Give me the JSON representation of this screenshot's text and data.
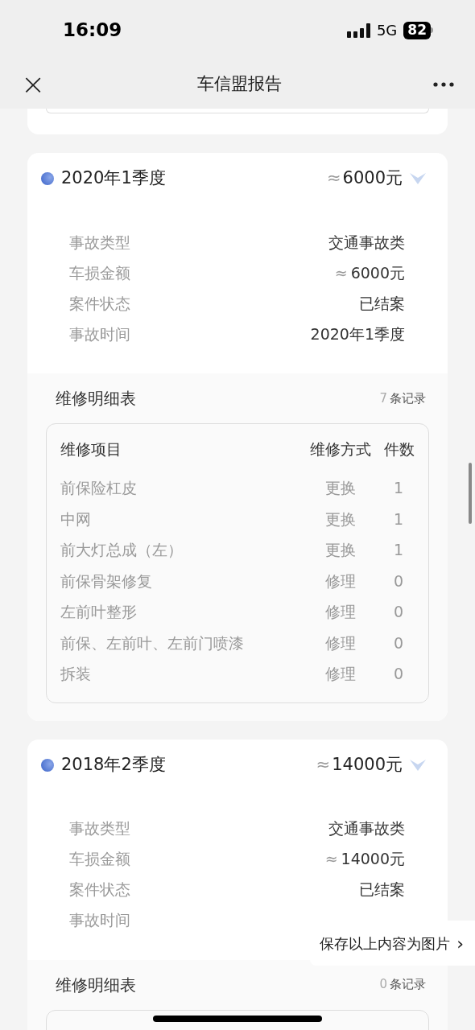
{
  "status_bar": {
    "time": "16:09",
    "network": "5G",
    "battery": "82"
  },
  "nav": {
    "close": "×",
    "title": "车信盟报告"
  },
  "records": [
    {
      "period": "2020年1季度",
      "approx": "≈",
      "amount": "6000元",
      "details": [
        {
          "label": "事故类型",
          "value": "交通事故类"
        },
        {
          "label": "车损金额",
          "approx": "≈",
          "value": "6000元"
        },
        {
          "label": "案件状态",
          "value": "已结案"
        },
        {
          "label": "事故时间",
          "value": "2020年1季度"
        }
      ],
      "repair": {
        "title": "维修明细表",
        "count": "7",
        "unit": "条记录",
        "columns": [
          "维修项目",
          "维修方式",
          "件数"
        ],
        "rows": [
          [
            "前保险杠皮",
            "更换",
            "1"
          ],
          [
            "中网",
            "更换",
            "1"
          ],
          [
            "前大灯总成（左）",
            "更换",
            "1"
          ],
          [
            "前保骨架修复",
            "修理",
            "0"
          ],
          [
            "左前叶整形",
            "修理",
            "0"
          ],
          [
            "前保、左前叶、左前门喷漆",
            "修理",
            "0"
          ],
          [
            "拆装",
            "修理",
            "0"
          ]
        ]
      }
    },
    {
      "period": "2018年2季度",
      "approx": "≈",
      "amount": "14000元",
      "details": [
        {
          "label": "事故类型",
          "value": "交通事故类"
        },
        {
          "label": "车损金额",
          "approx": "≈",
          "value": "14000元"
        },
        {
          "label": "案件状态",
          "value": "已结案"
        },
        {
          "label": "事故时间"
        }
      ],
      "repair": {
        "title": "维修明细表",
        "count": "0",
        "unit": "条记录"
      }
    }
  ],
  "save_button": {
    "label": "保存以上内容为图片",
    "arrow": "›"
  }
}
